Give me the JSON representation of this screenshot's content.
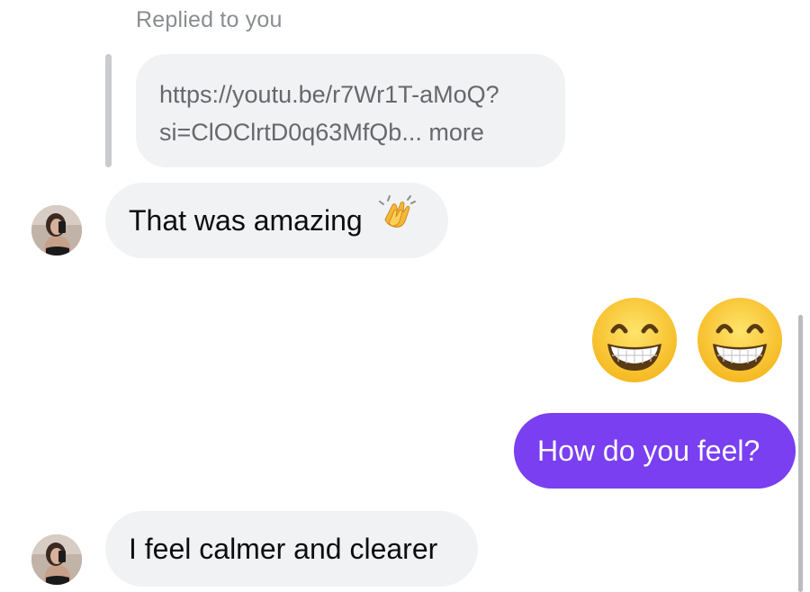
{
  "reply_context": {
    "label": "Replied to you",
    "quoted_link_line1": "https://youtu.be/r7Wr1T-aMoQ?",
    "quoted_link_line2": "si=ClOClrtD0q63MfQb... more"
  },
  "messages": [
    {
      "id": "m1",
      "direction": "incoming",
      "text": "That was amazing",
      "emoji": "clapping-hands-icon"
    },
    {
      "id": "m2",
      "direction": "outgoing",
      "emoji_only": [
        "grinning-face-icon",
        "grinning-face-icon"
      ]
    },
    {
      "id": "m3",
      "direction": "outgoing",
      "text": "How do you feel?"
    },
    {
      "id": "m4",
      "direction": "incoming",
      "text": "I feel calmer and clearer"
    }
  ],
  "colors": {
    "incoming_bubble": "#f1f2f4",
    "outgoing_bubble": "#7a3ff0",
    "muted_text": "#8a8d91",
    "emoji_yellow": "#ffd84d"
  }
}
